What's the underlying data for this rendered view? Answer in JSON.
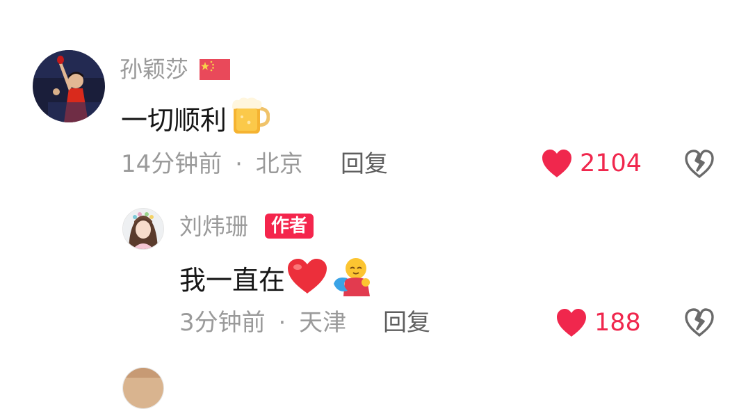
{
  "comments": [
    {
      "username": "孙颖莎",
      "flag_icon": "china-flag",
      "text": "一切顺利",
      "emoji_icons": [
        "beer-mug-emoji"
      ],
      "time": "14分钟前",
      "location": "北京",
      "separator": "·",
      "reply_label": "回复",
      "like_count": "2104"
    },
    {
      "username": "刘炜珊",
      "badge": "作者",
      "text": "我一直在",
      "emoji_icons": [
        "red-heart-emoji",
        "hugging-person-emoji"
      ],
      "time": "3分钟前",
      "location": "天津",
      "separator": "·",
      "reply_label": "回复",
      "like_count": "188"
    }
  ],
  "colors": {
    "like": "#f0274d",
    "badge": "#f4254c",
    "meta": "#9a9a9a"
  }
}
